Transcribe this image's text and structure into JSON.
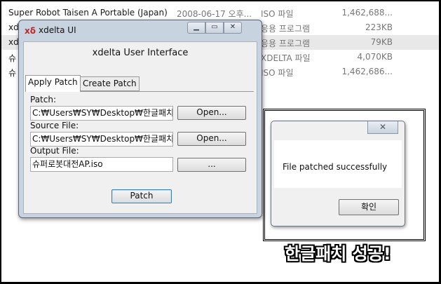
{
  "explorer": {
    "rows": [
      {
        "name": "Super Robot Taisen A Portable (Japan)",
        "date": "2008-06-17 오후...",
        "type": "ISO 파일",
        "size": "1,462,688..."
      },
      {
        "name": "xd",
        "date": "",
        "type": "응용 프로그램",
        "size": "223KB"
      },
      {
        "name": "xd",
        "date": "",
        "type": "응용 프로그램",
        "size": "79KB"
      },
      {
        "name": "슈",
        "date": "",
        "type": "XDELTA 파일",
        "size": "4,070KB"
      },
      {
        "name": "슈",
        "date": "",
        "type": "ISO 파일",
        "size": "1,462,686..."
      }
    ]
  },
  "xdelta_window": {
    "title": "xdelta UI",
    "logo_text": "xδ",
    "header": "xdelta User Interface",
    "tabs": [
      "Apply Patch",
      "Create Patch"
    ],
    "patch_label": "Patch:",
    "patch_value": "C:₩Users₩SY₩Desktop₩한글패치",
    "patch_open_label": "Open...",
    "source_label": "Source File:",
    "source_value": "C:₩Users₩SY₩Desktop₩한글패치",
    "source_open_label": "Open...",
    "output_label": "Output File:",
    "output_value": "슈퍼로봇대전AP.iso",
    "output_browse_label": "...",
    "patch_button_label": "Patch"
  },
  "dialog": {
    "close_glyph": "✕",
    "message": "File patched successfully",
    "ok_label": "확인"
  },
  "caption": "한글패치 성공!"
}
